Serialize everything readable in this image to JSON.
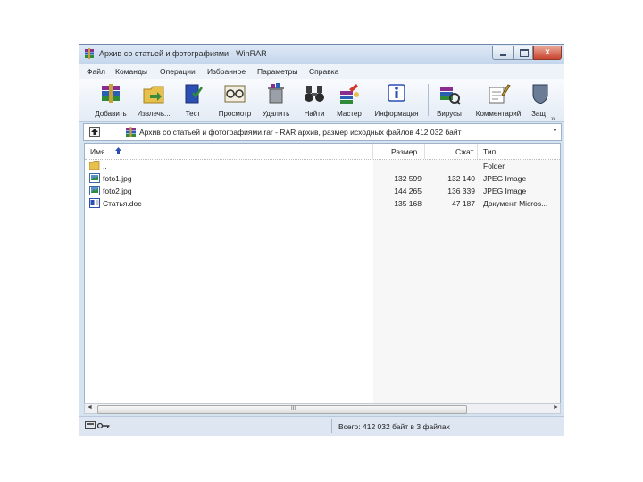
{
  "window": {
    "title": "Архив со статьей и фотографиями - WinRAR"
  },
  "menu": [
    "Файл",
    "Команды",
    "Операции",
    "Избранное",
    "Параметры",
    "Справка"
  ],
  "toolbar": {
    "buttons": [
      {
        "label": "Добавить",
        "icon": "archive-books-icon"
      },
      {
        "label": "Извлечь...",
        "icon": "extract-folder-icon"
      },
      {
        "label": "Тест",
        "icon": "test-book-icon"
      },
      {
        "label": "Просмотр",
        "icon": "view-glasses-icon"
      },
      {
        "label": "Удалить",
        "icon": "delete-trash-icon"
      },
      {
        "label": "Найти",
        "icon": "binoculars-icon"
      },
      {
        "label": "Мастер",
        "icon": "wizard-icon"
      },
      {
        "label": "Информация",
        "icon": "info-icon"
      },
      {
        "label": "Вирусы",
        "icon": "virus-scan-icon"
      },
      {
        "label": "Комментарий",
        "icon": "comment-pen-icon"
      },
      {
        "label": "Защ",
        "icon": "protect-icon"
      }
    ],
    "more": "»"
  },
  "address": {
    "text": "Архив со статьей и фотографиями.rar - RAR архив, размер исходных файлов 412 032 байт",
    "arrow": "▼"
  },
  "columns": {
    "name": "Имя",
    "size": "Размер",
    "packed": "Сжат",
    "type": "Тип"
  },
  "files": [
    {
      "name": "..",
      "size": "",
      "packed": "",
      "type": "Folder",
      "icon": "folder-up-icon"
    },
    {
      "name": "foto1.jpg",
      "size": "132 599",
      "packed": "132 140",
      "type": "JPEG Image",
      "icon": "image-file-icon"
    },
    {
      "name": "foto2.jpg",
      "size": "144 265",
      "packed": "136 339",
      "type": "JPEG Image",
      "icon": "image-file-icon"
    },
    {
      "name": "Статья.doc",
      "size": "135 168",
      "packed": "47 187",
      "type": "Документ Micros...",
      "icon": "word-document-icon"
    }
  ],
  "scrollbar": {
    "left": "◄",
    "right": "►",
    "grip": "III"
  },
  "status": {
    "text": "Всего: 412 032 байт в 3 файлах"
  },
  "colors": {
    "window_frame": "#d6e3f1",
    "close_button": "#c9452f",
    "toolbar": "#e3ebf5"
  }
}
